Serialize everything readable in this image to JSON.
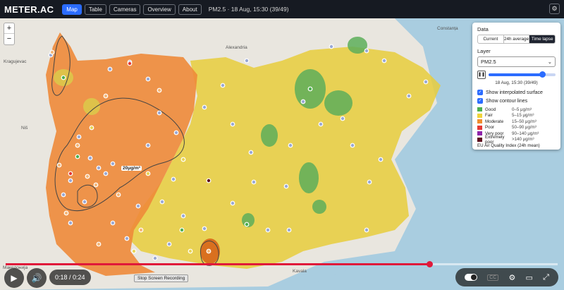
{
  "navbar": {
    "brand": "METER.AC",
    "tabs": [
      {
        "label": "Map",
        "active": true
      },
      {
        "label": "Table",
        "active": false
      },
      {
        "label": "Cameras",
        "active": false
      },
      {
        "label": "Overview",
        "active": false
      },
      {
        "label": "About",
        "active": false
      }
    ],
    "status": "PM2.5 · 18 Aug, 15:30 (39/49)",
    "settings_icon": "gear-icon"
  },
  "map": {
    "zoom_in": "+",
    "zoom_out": "−",
    "contour_label": "20μg/m³",
    "place_labels": [
      "Constanța",
      "Alexandria",
      "Kragujevac",
      "Niš",
      "Македонија",
      "Kavala"
    ]
  },
  "panel": {
    "data_title": "Data",
    "data_modes": [
      "Current",
      "24h average",
      "Time lapse"
    ],
    "data_mode_selected": "Time lapse",
    "layer_title": "Layer",
    "layer_value": "PM2.5",
    "timelapse_position": 0.8,
    "timelapse_label": "18 Aug, 15:30 (39/49)",
    "checkbox_interpolated": "Show interpolated surface",
    "checkbox_contours": "Show contour lines",
    "legend": [
      {
        "name": "Good",
        "range": "0–5 μg/m³",
        "color": "#4caf50"
      },
      {
        "name": "Fair",
        "range": "5–15 μg/m³",
        "color": "#f0d43a"
      },
      {
        "name": "Moderate",
        "range": "15–50 μg/m³",
        "color": "#f08c2e"
      },
      {
        "name": "Poor",
        "range": "50–90 μg/m³",
        "color": "#e53935"
      },
      {
        "name": "Very poor",
        "range": "90–140 μg/m³",
        "color": "#8e24aa"
      },
      {
        "name": "Extremely poor",
        "range": ">140 μg/m³",
        "color": "#5d0f1f"
      }
    ],
    "legend_footer": "EU Air Quality Index (24h mean)"
  },
  "video": {
    "progress": 0.768,
    "time": "0:18 / 0:24",
    "stop_recording": "Stop Screen Recording"
  }
}
